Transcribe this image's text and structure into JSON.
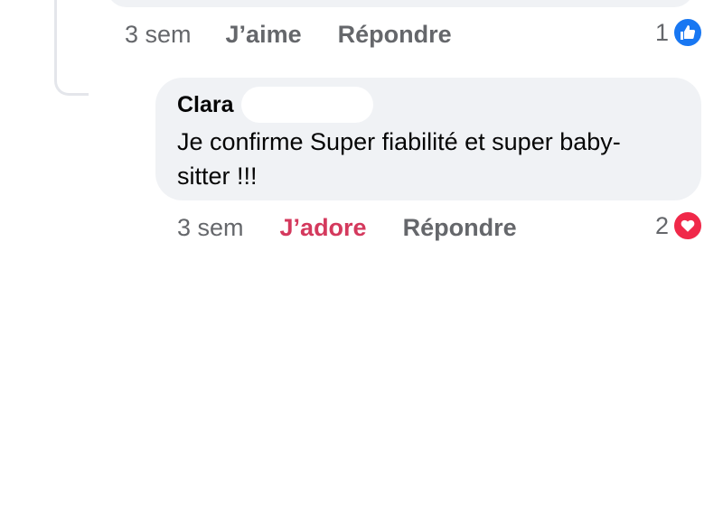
{
  "parent_comment": {
    "time": "3 sem",
    "action_like": "J’aime",
    "action_reply": "Répondre",
    "reaction_count": "1",
    "reaction_icon": "thumbs-up-icon",
    "reaction_color": "#1877f2"
  },
  "reply_comment": {
    "author": "Clara",
    "text": "Je confirme Super fiabilité et super baby-sitter !!!",
    "time": "3 sem",
    "action_love": "J’adore",
    "action_reply": "Répondre",
    "reaction_count": "2",
    "reaction_icon": "heart-icon",
    "reaction_color": "#f02849"
  },
  "colors": {
    "bubble": "#f0f2f5",
    "meta_text": "#65676b",
    "love_text": "#d4395d"
  }
}
